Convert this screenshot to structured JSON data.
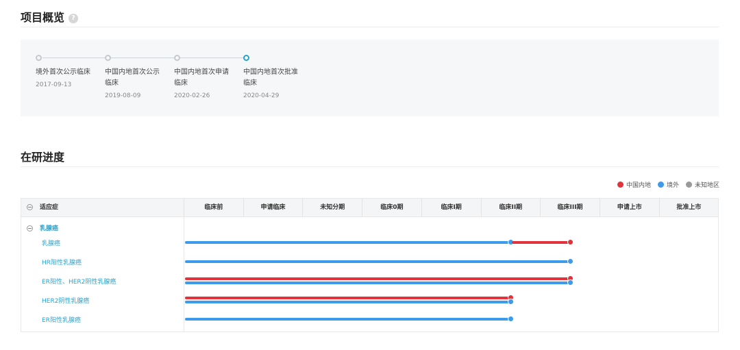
{
  "overview": {
    "title": "项目概览",
    "help_icon": "?",
    "milestones": [
      {
        "name": "境外首次公示临床",
        "date": "2017-09-13",
        "active": false
      },
      {
        "name": "中国内地首次公示临床",
        "date": "2019-08-09",
        "active": false
      },
      {
        "name": "中国内地首次申请临床",
        "date": "2020-02-26",
        "active": false
      },
      {
        "name": "中国内地首次批准临床",
        "date": "2020-04-29",
        "active": true
      }
    ]
  },
  "progress": {
    "title": "在研进度",
    "legend": [
      {
        "label": "中国内地",
        "color": "#e0333c"
      },
      {
        "label": "境外",
        "color": "#3d9be9"
      },
      {
        "label": "未知地区",
        "color": "#9a9a9a"
      }
    ],
    "header_first": "适应症",
    "phases": [
      "临床前",
      "申请临床",
      "未知分期",
      "临床0期",
      "临床I期",
      "临床II期",
      "临床III期",
      "申请上市",
      "批准上市"
    ],
    "group": "乳腺癌",
    "rows": [
      {
        "label": "乳腺癌",
        "bars": [
          {
            "region": "境外",
            "start": 0,
            "end": 5.5
          },
          {
            "region": "中国内地",
            "start": 5.5,
            "end": 6.5
          }
        ]
      },
      {
        "label": "HR阳性乳腺癌",
        "bars": [
          {
            "region": "境外",
            "start": 0,
            "end": 6.5
          }
        ]
      },
      {
        "label": "ER阳性、HER2阴性乳腺癌",
        "bars": [
          {
            "region": "中国内地",
            "start": 0,
            "end": 6.5
          },
          {
            "region": "境外",
            "start": 0,
            "end": 6.5
          }
        ]
      },
      {
        "label": "HER2阴性乳腺癌",
        "bars": [
          {
            "region": "中国内地",
            "start": 0,
            "end": 5.5
          },
          {
            "region": "境外",
            "start": 0,
            "end": 5.5
          }
        ]
      },
      {
        "label": "ER阳性乳腺癌",
        "bars": [
          {
            "region": "境外",
            "start": 0,
            "end": 5.5
          }
        ]
      }
    ]
  }
}
